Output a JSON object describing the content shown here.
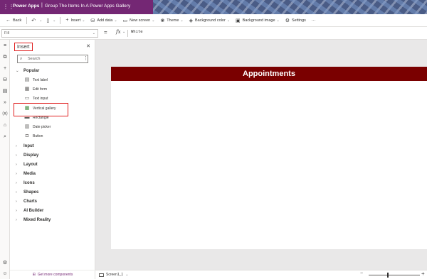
{
  "titlebar": {
    "app_name": "Power Apps",
    "separator": "|",
    "doc_title": "Group The Items In A Power Apps Gallery",
    "waffle_icon": "waffle-icon"
  },
  "commandbar": {
    "back": "Back",
    "insert": "Insert",
    "add_data": "Add data",
    "new_screen": "New screen",
    "theme": "Theme",
    "background_color": "Background color",
    "background_image": "Background image",
    "settings": "Settings",
    "more": "···"
  },
  "formulabar": {
    "property": "Fill",
    "equals": "=",
    "fx": "fx",
    "formula": "White"
  },
  "insert_panel": {
    "title": "Insert",
    "search_placeholder": "Search",
    "popular_label": "Popular",
    "popular_items": [
      {
        "label": "Text label",
        "icon": "text-label-icon"
      },
      {
        "label": "Edit form",
        "icon": "edit-form-icon"
      },
      {
        "label": "Text input",
        "icon": "text-input-icon"
      },
      {
        "label": "Vertical gallery",
        "icon": "vertical-gallery-icon"
      },
      {
        "label": "Rectangle",
        "icon": "rectangle-icon"
      },
      {
        "label": "Date picker",
        "icon": "date-picker-icon"
      },
      {
        "label": "Button",
        "icon": "button-icon"
      }
    ],
    "categories": [
      "Input",
      "Display",
      "Layout",
      "Media",
      "Icons",
      "Shapes",
      "Charts",
      "AI Builder",
      "Mixed Reality"
    ],
    "get_more": "Get more components"
  },
  "canvas": {
    "header_title": "Appointments",
    "header_color": "#7a0000"
  },
  "statusbar": {
    "screen_name": "Screen1_1",
    "zoom_minus": "−",
    "zoom_plus": "+",
    "zoom_level_fraction": 0.36
  },
  "colors": {
    "brand": "#742774",
    "highlight_box": "#e02020"
  }
}
